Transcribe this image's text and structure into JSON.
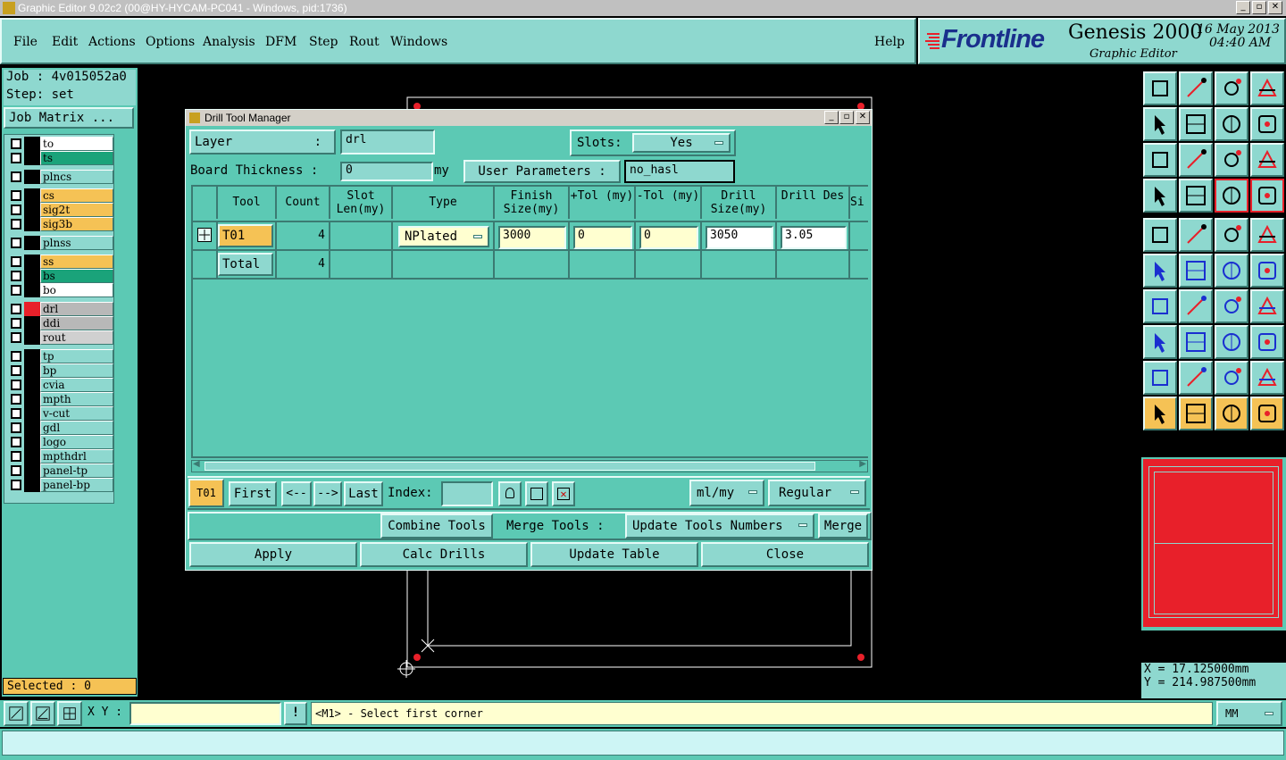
{
  "window": {
    "title": "Graphic Editor 9.02c2 (00@HY-HYCAM-PC041 - Windows, pid:1736)"
  },
  "menu": {
    "items": [
      "File",
      "Edit",
      "Actions",
      "Options",
      "Analysis",
      "DFM",
      "Step",
      "Rout",
      "Windows"
    ],
    "help": "Help"
  },
  "brand": {
    "logo": "Frontline",
    "product": "Genesis 2000",
    "subtitle": "Graphic Editor",
    "date": "16 May 2013",
    "time": "04:40 AM"
  },
  "job": {
    "job_label": "Job : 4v015052a0",
    "step_label": "Step: set",
    "matrix_button": "Job Matrix ..."
  },
  "layers": [
    {
      "name": "to",
      "color": "#ffffff"
    },
    {
      "name": "ts",
      "color": "#1aa37a"
    },
    {
      "name": "plncs",
      "color": "#8ed8cf"
    },
    {
      "name": "cs",
      "color": "#f5c255"
    },
    {
      "name": "sig2t",
      "color": "#f5c255"
    },
    {
      "name": "sig3b",
      "color": "#f5c255"
    },
    {
      "name": "plnss",
      "color": "#8ed8cf"
    },
    {
      "name": "ss",
      "color": "#f5c255"
    },
    {
      "name": "bs",
      "color": "#1aa37a"
    },
    {
      "name": "bo",
      "color": "#ffffff"
    },
    {
      "name": "drl",
      "color": "#b8b8b8"
    },
    {
      "name": "ddi",
      "color": "#b8b8b8"
    },
    {
      "name": "rout",
      "color": "#d0d0d0"
    },
    {
      "name": "tp",
      "color": "#8ed8cf"
    },
    {
      "name": "bp",
      "color": "#8ed8cf"
    },
    {
      "name": "cvia",
      "color": "#8ed8cf"
    },
    {
      "name": "mpth",
      "color": "#8ed8cf"
    },
    {
      "name": "v-cut",
      "color": "#8ed8cf"
    },
    {
      "name": "gdl",
      "color": "#8ed8cf"
    },
    {
      "name": "logo",
      "color": "#8ed8cf"
    },
    {
      "name": "mpthdrl",
      "color": "#8ed8cf"
    },
    {
      "name": "panel-tp",
      "color": "#8ed8cf"
    },
    {
      "name": "panel-bp",
      "color": "#8ed8cf"
    }
  ],
  "selected_label": "Selected : 0",
  "dialog": {
    "title": "Drill Tool Manager",
    "layer_label": "Layer",
    "layer_colon": ":",
    "layer_value": "drl",
    "slots_label": "Slots:",
    "slots_value": "Yes",
    "board_thickness_label": "Board Thickness :",
    "board_thickness_value": "0",
    "board_thickness_unit": "my",
    "user_params_label": "User Parameters :",
    "user_params_value": "no_hasl",
    "columns": [
      "Tool",
      "Count",
      "Slot Len(my)",
      "Type",
      "Finish Size(my)",
      "+Tol (my)",
      "-Tol (my)",
      "Drill Size(my)",
      "Drill Des",
      "Si"
    ],
    "row": {
      "tool": "T01",
      "count": "4",
      "type": "NPlated",
      "finish_size": "3000",
      "plus_tol": "0",
      "minus_tol": "0",
      "drill_size": "3050",
      "drill_des": "3.05"
    },
    "total": {
      "label": "Total",
      "count": "4"
    },
    "nav": {
      "current_tool": "T01",
      "first": "First",
      "prev": "<--",
      "next": "-->",
      "last": "Last",
      "index_label": "Index:",
      "index_value": "",
      "units": "ml/my",
      "mode": "Regular"
    },
    "combine_tools": "Combine Tools",
    "merge_tools_label": "Merge Tools :",
    "update_tools_numbers": "Update Tools Numbers",
    "merge": "Merge",
    "apply": "Apply",
    "calc_drills": "Calc Drills",
    "update_table": "Update Table",
    "close": "Close"
  },
  "coords": {
    "x": "X  =  17.125000mm",
    "y": "Y  = 214.987500mm"
  },
  "bottom": {
    "xy_label": "X Y :",
    "xy_value": "",
    "prompt": "<M1> - Select first corner",
    "units": "MM",
    "status": ""
  }
}
